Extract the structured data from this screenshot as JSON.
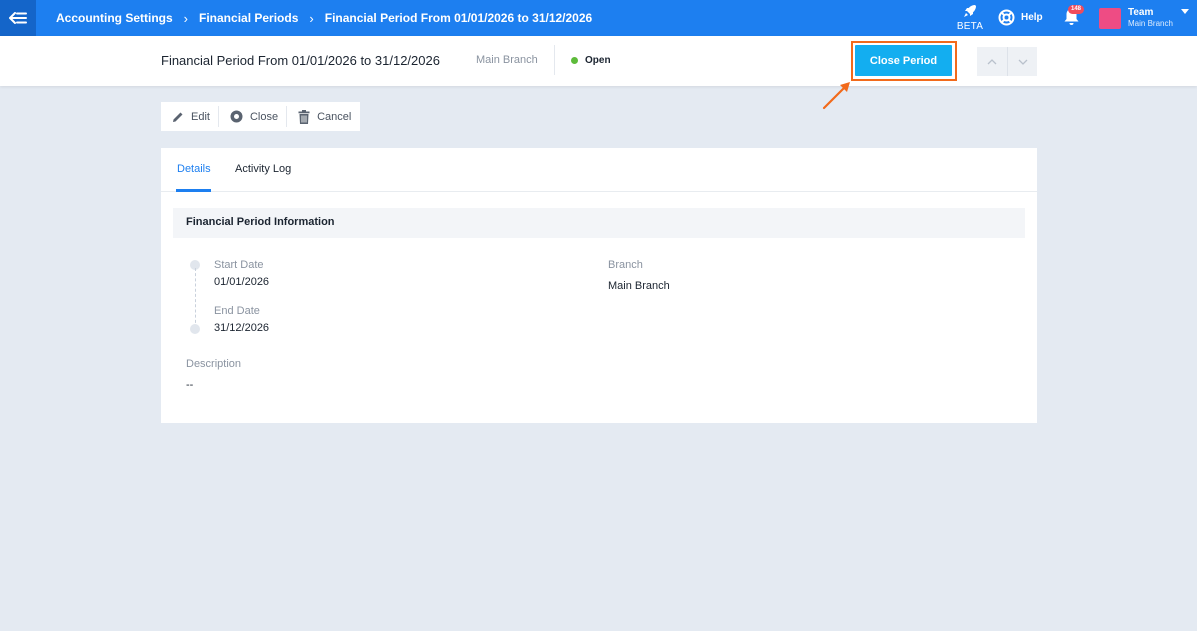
{
  "topbar": {
    "breadcrumb": [
      "Accounting Settings",
      "Financial Periods",
      "Financial Period From 01/01/2026 to 31/12/2026"
    ],
    "beta_label": "BETA",
    "help_label": "Help",
    "notification_count": "148",
    "user_name": "Team",
    "user_branch": "Main Branch",
    "brand_color": "#1d7ff0",
    "avatar_color": "#ee4c84"
  },
  "header": {
    "title": "Financial Period From 01/01/2026 to 31/12/2026",
    "branch": "Main Branch",
    "status": "Open",
    "status_color": "#5dbb3a",
    "close_period_label": "Close Period",
    "close_period_color": "#13aef0",
    "highlight_color": "#f26a1b"
  },
  "toolbar": {
    "edit_label": "Edit",
    "close_label": "Close",
    "cancel_label": "Cancel"
  },
  "tabs": [
    {
      "label": "Details",
      "active": true
    },
    {
      "label": "Activity Log",
      "active": false
    }
  ],
  "details": {
    "section_title": "Financial Period Information",
    "start_date_label": "Start Date",
    "start_date": "01/01/2026",
    "end_date_label": "End Date",
    "end_date": "31/12/2026",
    "branch_label": "Branch",
    "branch": "Main Branch",
    "description_label": "Description",
    "description": "--"
  }
}
